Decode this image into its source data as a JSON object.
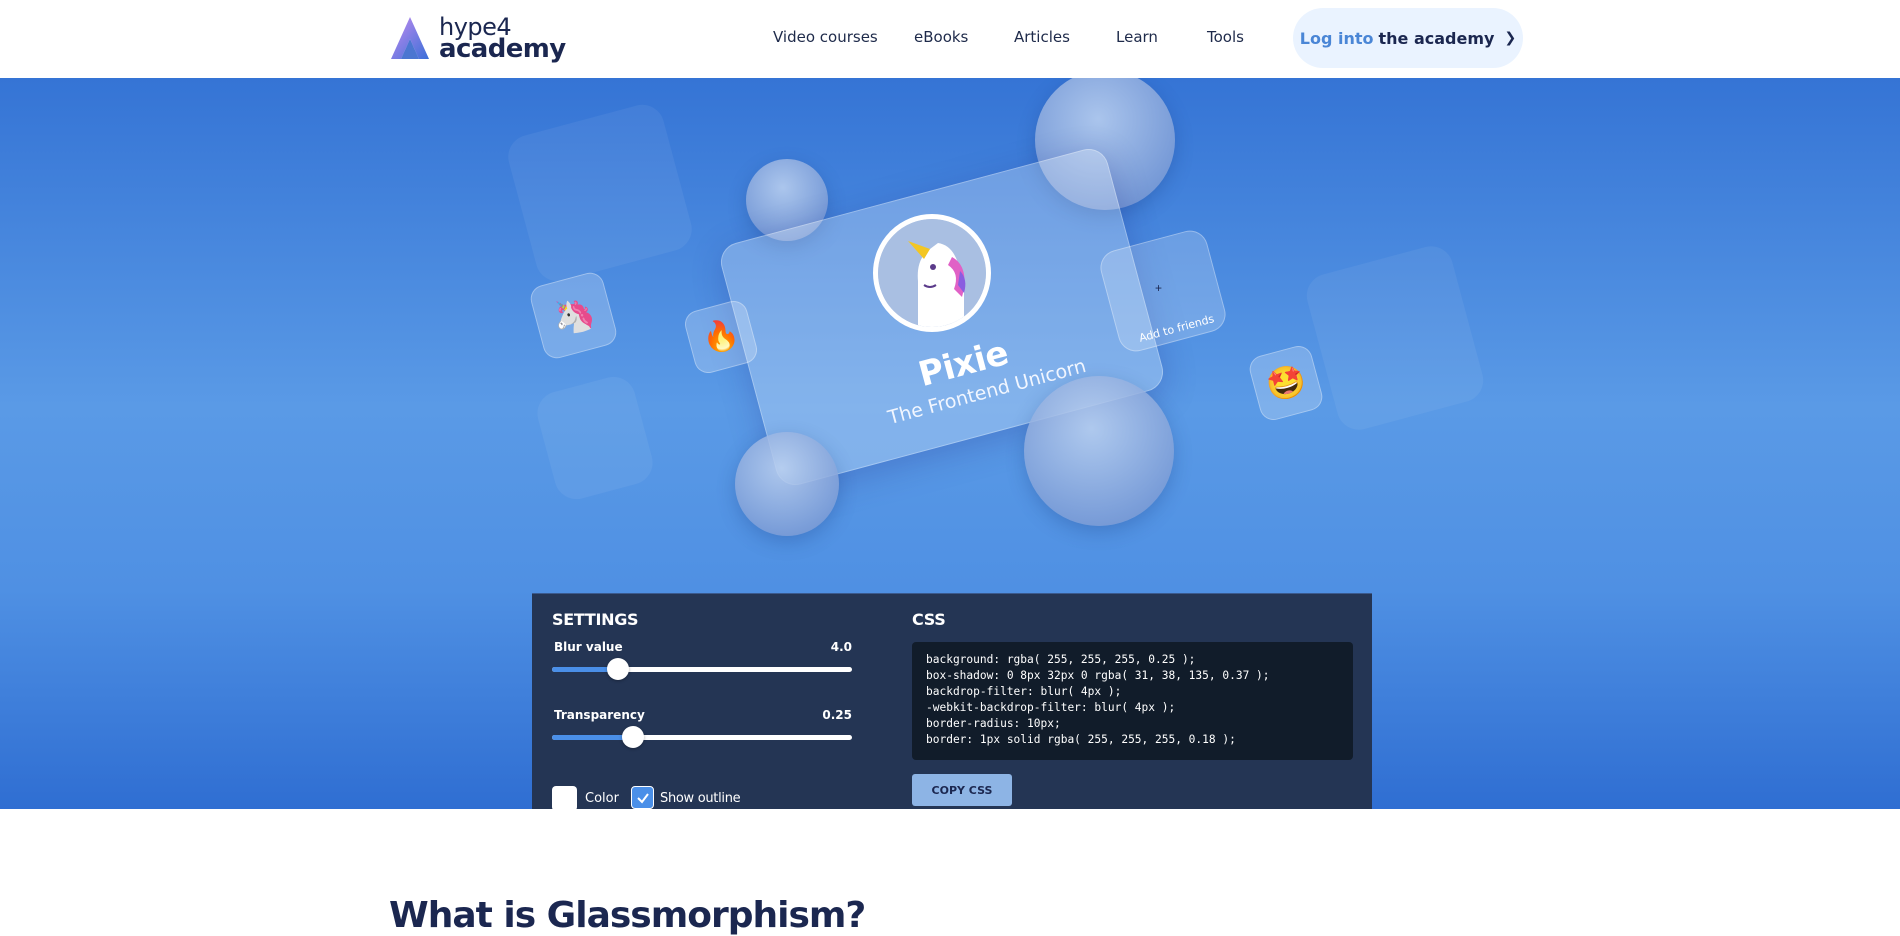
{
  "logo": {
    "line1": "hype4",
    "line2": "academy"
  },
  "nav": [
    {
      "label": "Video courses"
    },
    {
      "label": "eBooks"
    },
    {
      "label": "Articles"
    },
    {
      "label": "Learn"
    },
    {
      "label": "Tools"
    }
  ],
  "login": {
    "accent": "Log into",
    "rest": "the academy"
  },
  "card": {
    "name": "Pixie",
    "subtitle": "The Frontend Unicorn",
    "friends_label": "Add to friends",
    "friends_plus": "+"
  },
  "tiles": [
    "unicorn-emoji",
    "fire-emoji",
    "star-struck-emoji"
  ],
  "settings": {
    "title": "SETTINGS",
    "blur": {
      "label": "Blur value",
      "value": "4.0",
      "fraction": 0.22
    },
    "transparency": {
      "label": "Transparency",
      "value": "0.25",
      "fraction": 0.27
    },
    "color_label": "Color",
    "color_value": "#ffffff",
    "outline_label": "Show outline",
    "outline_checked": true
  },
  "css": {
    "title": "CSS",
    "lines": [
      "background: rgba( 255, 255, 255, 0.25 );",
      "box-shadow: 0 8px 32px 0 rgba( 31, 38, 135, 0.37 );",
      "backdrop-filter: blur( 4px );",
      "-webkit-backdrop-filter: blur( 4px );",
      "border-radius: 10px;",
      "border: 1px solid rgba( 255, 255, 255, 0.18 );"
    ],
    "copy_label": "COPY CSS"
  },
  "section_heading": "What is Glassmorphism?",
  "colors": {
    "accent": "#4a8fe8",
    "panel": "#243554",
    "hero": "#4f90e3",
    "brand_dark": "#1b2750"
  }
}
